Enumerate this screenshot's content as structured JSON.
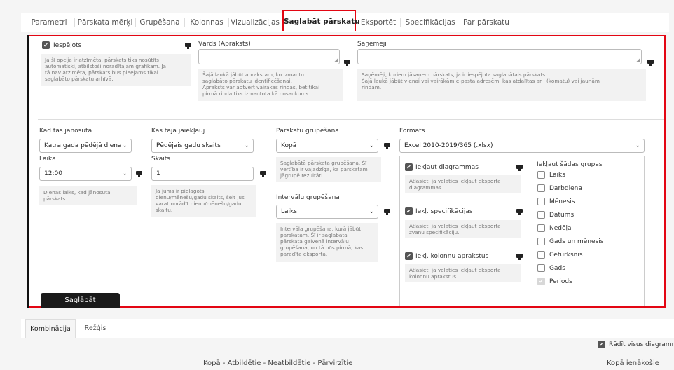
{
  "tabs": [
    {
      "label": "Parametri"
    },
    {
      "label": "Pārskata mērķi"
    },
    {
      "label": "Grupēšana"
    },
    {
      "label": "Kolonnas"
    },
    {
      "label": "Vizualizācijas"
    },
    {
      "label": "Saglabāt pārskatu"
    },
    {
      "label": "Eksportēt"
    },
    {
      "label": "Specifikācijas"
    },
    {
      "label": "Par pārskatu"
    }
  ],
  "enabled": {
    "label": "Iespējots",
    "checked": true,
    "hint": "Ja šī opcija ir atzīmēta, pārskats tiks nosūtīts\nautomātiski, atbilstoši norādītajam grafikam. Ja\ntā nav atzīmēta, pārskats būs pieejams tikai\nsaglabāto pārskatu arhīvā."
  },
  "name": {
    "label": "Vārds (Apraksts)",
    "value": "",
    "hint": "Šajā laukā jābūt aprakstam, ko izmanto\nsaglabāto pārskatu identificēšanai.\nApraksts var aptvert vairākas rindas, bet tikai\npirmā rinda tiks izmantota kā nosaukums."
  },
  "recipients": {
    "label": "Saņēmēji",
    "value": "",
    "hint": "Saņēmēji, kuriem jāsaņem pārskats, ja ir iespējota saglabātais pārskats.\nŠajā laukā jābūt vienai vai vairākām e-pasta adresēm, kas atdalītas ar , (komatu) vai jaunām\nrindām."
  },
  "send_when": {
    "label": "Kad tas jānosūta",
    "value": "Katra gada pēdējā diena"
  },
  "time": {
    "label": "Laikā",
    "value": "12:00",
    "hint": "Dienas laiks, kad jānosūta\npārskats."
  },
  "include": {
    "label": "Kas tajā jāiekļauj",
    "value": "Pēdējais gadu skaits"
  },
  "count": {
    "label": "Skaits",
    "value": "1",
    "hint": "Ja jums ir pielāgots\ndienu/mēnešu/gadu skaits, šeit jūs\nvarat norādīt dienu/mēnešu/gadu\nskaitu."
  },
  "grouping": {
    "label": "Pārskatu grupēšana",
    "value": "Kopā",
    "hint": "Saglabātā pārskata grupēšana. Šī\nvērtība ir vajadzīga, ka pārskatam\njāgrupē rezultāti."
  },
  "interval": {
    "label": "Intervālu grupēšana",
    "value": "Laiks",
    "hint": "Intervāla grupēšana, kurā jābūt\npārskatam. Šī ir saglabātā\npārskata galvenā intervālu\ngrupēšana, un tā būs pirmā, kas\nparādīta eksportā."
  },
  "format": {
    "label": "Formāts",
    "value": "Excel 2010-2019/365 (.xlsx)"
  },
  "options": [
    {
      "label": "Iekļaut diagrammas",
      "hint": "Atlasiet, ja vēlaties iekļaut eksportā\ndiagrammas."
    },
    {
      "label": "Iekļ. specifikācijas",
      "hint": "Atlasiet, ja vēlaties iekļaut eksportā\nzvanu specifikāciju."
    },
    {
      "label": "Iekļ. kolonnu aprakstus",
      "hint": "Atlasiet, ja vēlaties iekļaut eksportā\nkolonnu aprakstus."
    }
  ],
  "groups": {
    "label": "Iekļaut šādas grupas",
    "items": [
      {
        "label": "Laiks",
        "state": "unchecked"
      },
      {
        "label": "Darbdiena",
        "state": "unchecked"
      },
      {
        "label": "Mēnesis",
        "state": "unchecked"
      },
      {
        "label": "Datums",
        "state": "unchecked"
      },
      {
        "label": "Nedēļa",
        "state": "unchecked"
      },
      {
        "label": "Gads un mēnesis",
        "state": "unchecked"
      },
      {
        "label": "Ceturksnis",
        "state": "unchecked"
      },
      {
        "label": "Gads",
        "state": "unchecked"
      },
      {
        "label": "Periods",
        "state": "disabled-checked"
      }
    ]
  },
  "save_button": "Saglābāt",
  "bottom_tabs": [
    {
      "label": "Kombinācija"
    },
    {
      "label": "Režģis"
    }
  ],
  "show_all_charts": "Rādīt visus diagramm",
  "chart_title_left": "Kopā - Atbildētie - Neatbildētie - Pārvirzītie",
  "chart_title_right": "Kopā ienākošie"
}
